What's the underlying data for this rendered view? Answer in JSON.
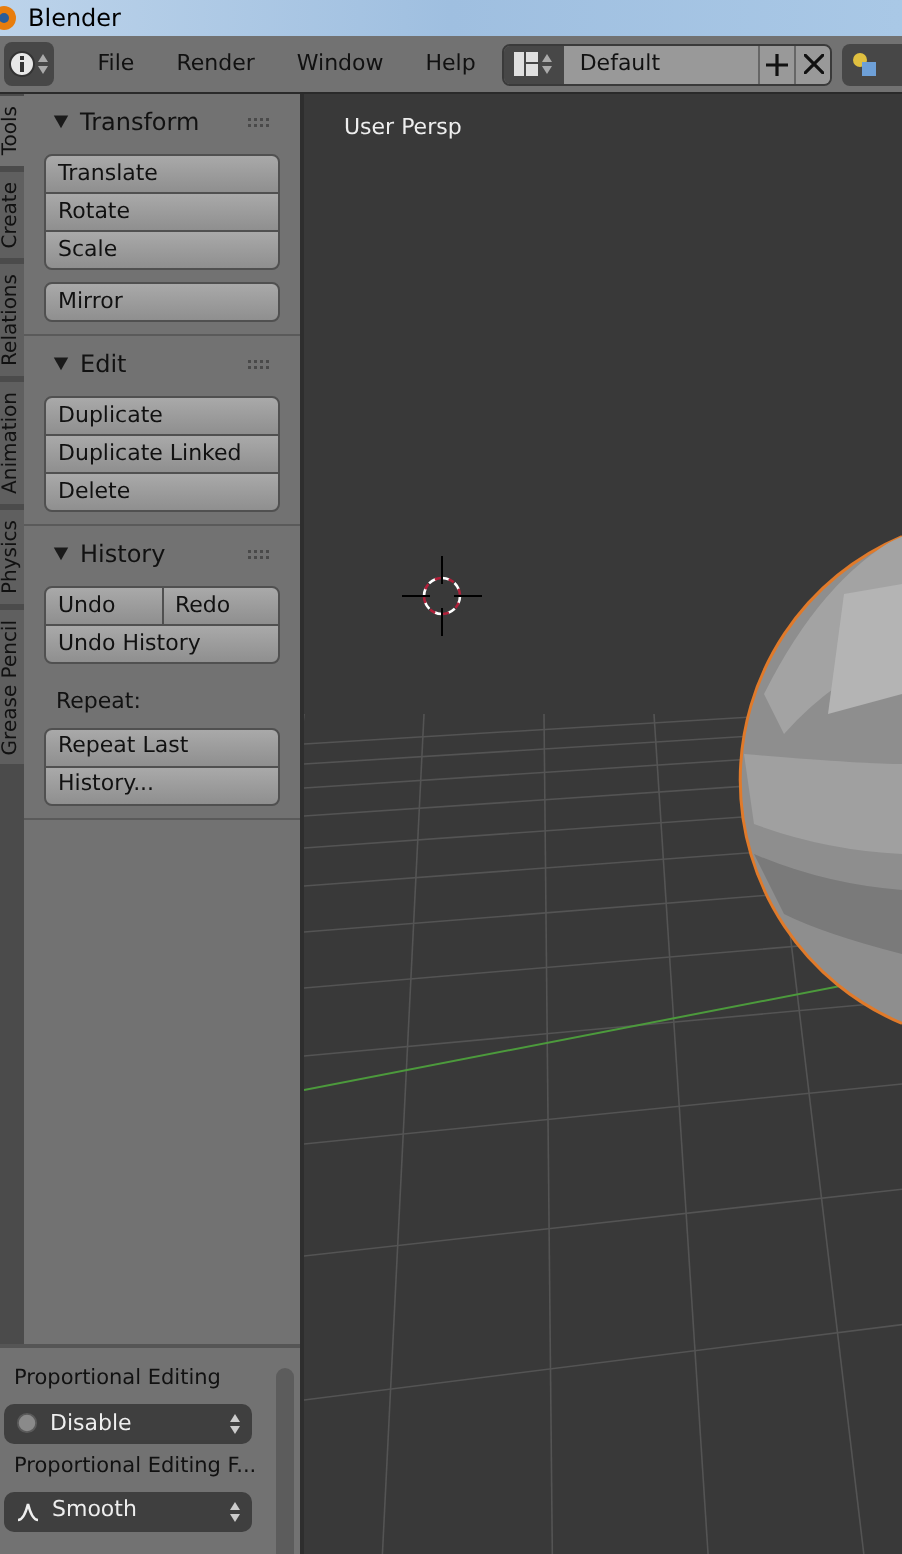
{
  "window": {
    "title": "Blender"
  },
  "menu_bar": {
    "menus": [
      "File",
      "Render",
      "Window",
      "Help"
    ],
    "screen_layout": {
      "value": "Default"
    }
  },
  "side_tabs": [
    {
      "label": "Tools",
      "selected": true
    },
    {
      "label": "Create",
      "selected": false
    },
    {
      "label": "Relations",
      "selected": false
    },
    {
      "label": "Animation",
      "selected": false
    },
    {
      "label": "Physics",
      "selected": false
    },
    {
      "label": "Grease Pencil",
      "selected": false
    }
  ],
  "tool_panels": [
    {
      "title": "Transform",
      "expanded": true,
      "blocks": [
        {
          "kind": "buttons",
          "rows": [
            [
              "Translate"
            ],
            [
              "Rotate"
            ],
            [
              "Scale"
            ]
          ]
        },
        {
          "kind": "buttons",
          "rows": [
            [
              "Mirror"
            ]
          ]
        }
      ]
    },
    {
      "title": "Edit",
      "expanded": true,
      "blocks": [
        {
          "kind": "buttons",
          "rows": [
            [
              "Duplicate"
            ],
            [
              "Duplicate Linked"
            ],
            [
              "Delete"
            ]
          ]
        }
      ]
    },
    {
      "title": "History",
      "expanded": true,
      "blocks": [
        {
          "kind": "buttons",
          "rows": [
            [
              "Undo",
              "Redo"
            ],
            [
              "Undo History"
            ]
          ]
        },
        {
          "kind": "label",
          "text": "Repeat:"
        },
        {
          "kind": "buttons",
          "rows": [
            [
              "Repeat Last"
            ],
            [
              "History..."
            ]
          ]
        }
      ]
    }
  ],
  "operator_panel": {
    "fields": [
      {
        "label": "Proportional Editing",
        "value": "Disable",
        "kind": "circle"
      },
      {
        "label": "Proportional Editing F...",
        "value": "Smooth",
        "kind": "smooth"
      }
    ]
  },
  "viewport": {
    "view_label": "User Persp"
  }
}
